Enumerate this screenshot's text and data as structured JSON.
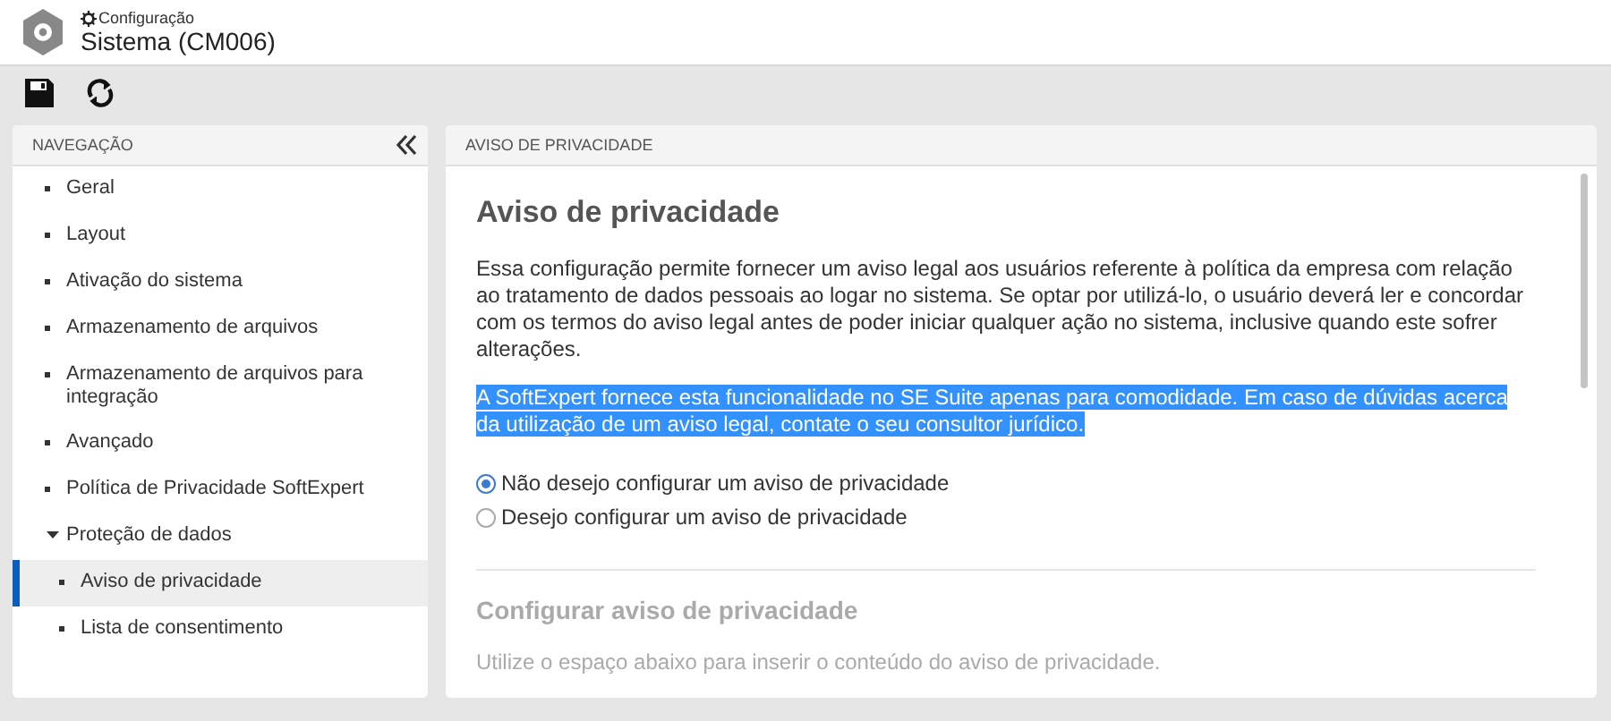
{
  "header": {
    "breadcrumb": "Configuração",
    "title": "Sistema (CM006)"
  },
  "toolbar": [
    {
      "kind": "save"
    },
    {
      "kind": "refresh"
    }
  ],
  "sidebar": {
    "title": "NAVEGAÇÃO",
    "items": [
      {
        "label": "Geral",
        "selected": false
      },
      {
        "label": "Layout",
        "selected": false
      },
      {
        "label": "Ativação do sistema",
        "selected": false
      },
      {
        "label": "Armazenamento de arquivos",
        "selected": false
      },
      {
        "label": "Armazenamento de arquivos para integração",
        "selected": false
      },
      {
        "label": "Avançado",
        "selected": false
      },
      {
        "label": "Política de Privacidade SoftExpert",
        "selected": false
      },
      {
        "label": "Proteção de dados",
        "selected": false,
        "expanded": true,
        "children": [
          {
            "label": "Aviso de privacidade",
            "selected": true
          },
          {
            "label": "Lista de consentimento",
            "selected": false
          }
        ]
      }
    ]
  },
  "panel": {
    "title": "AVISO DE PRIVACIDADE",
    "heading": "Aviso de privacidade",
    "paragraphs": [
      {
        "text": "Essa configuração permite fornecer um aviso legal aos usuários referente à política da empresa com relação ao tratamento de dados pessoais ao logar no sistema. Se optar por utilizá-lo, o usuário deverá ler e concordar com os termos do aviso legal antes de poder iniciar qualquer ação no sistema, inclusive quando este sofrer alterações.",
        "highlighted": false
      },
      {
        "text": "A SoftExpert fornece esta funcionalidade no SE Suite apenas para comodidade. Em caso de dúvidas acerca da utilização de um aviso legal, contate o seu consultor jurídico.",
        "highlighted": true
      }
    ],
    "options": [
      {
        "label": "Não desejo configurar um aviso de privacidade",
        "selected": true
      },
      {
        "label": "Desejo configurar um aviso de privacidade",
        "selected": false
      }
    ],
    "section": {
      "heading": "Configurar aviso de privacidade",
      "text": "Utilize o espaço abaixo para inserir o conteúdo do aviso de privacidade.",
      "disabled": true
    }
  }
}
